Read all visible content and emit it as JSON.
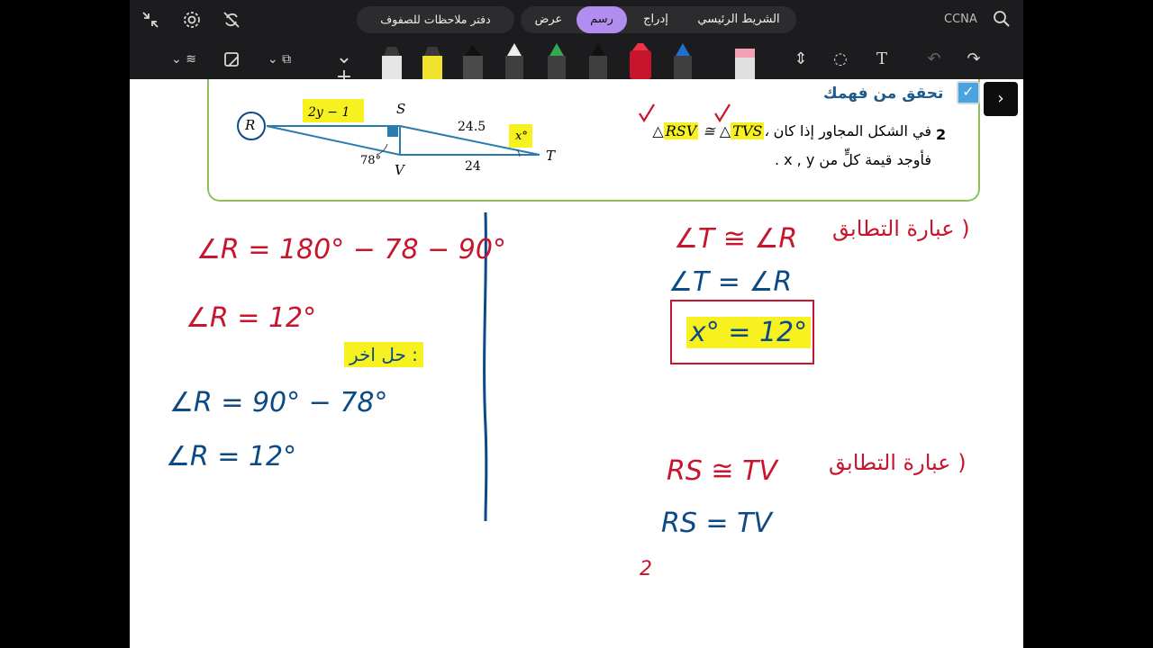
{
  "topbar": {
    "tabs": [
      {
        "label": "الشريط الرئيسي",
        "active": false
      },
      {
        "label": "إدراج",
        "active": false
      },
      {
        "label": "رسم",
        "active": true
      },
      {
        "label": "عرض",
        "active": false
      }
    ],
    "notebook_title": "دفتر ملاحظات للصفوف",
    "account": "CCNA",
    "icons": [
      "collapse-icon",
      "settings-icon",
      "sync-off-icon",
      "search-icon"
    ]
  },
  "toolbar": {
    "tools": [
      "lasso-icon",
      "eraser-icon",
      "shapes-icon",
      "add-icon",
      "highlighter-gray",
      "highlighter-yellow",
      "pen-black",
      "pen-white",
      "pen-green",
      "pen-black-2",
      "pen-red",
      "pen-blue",
      "eraser-pink",
      "insert-space-icon",
      "lasso-select-icon",
      "text-icon",
      "undo-icon",
      "redo-icon"
    ],
    "accent": "#b28df0"
  },
  "problem": {
    "title": "تحقق من فهمك",
    "number": "2",
    "line1": "في الشكل المجاور إذا كان △RSV ≅ △TVS،",
    "line2": "فأوجد قيمة كلٍّ من x , y .",
    "figure": {
      "labels": {
        "R": "R",
        "S": "S",
        "V": "V",
        "T": "T"
      },
      "rs_label": "2y − 1",
      "st_label": "24.5",
      "vt_label": "24",
      "angle_v": "78°",
      "angle_t": "x°"
    }
  },
  "notes": {
    "left": {
      "line1": "∠R = 180° − 78 − 90°",
      "line2": "∠R = 12°",
      "aside": "حل اخر :",
      "line3": "∠R = 90° − 78°",
      "line4": "∠R = 12°"
    },
    "right": {
      "line1": "∠T ≅ ∠R",
      "line1_note": "( عبارة التطابق",
      "line2": "∠T = ∠R",
      "boxed": "x° = 12°",
      "line3": "RS ≅ TV",
      "line3_note": "( عبارة التطابق",
      "line4": "RS = TV",
      "line5": "2"
    }
  }
}
